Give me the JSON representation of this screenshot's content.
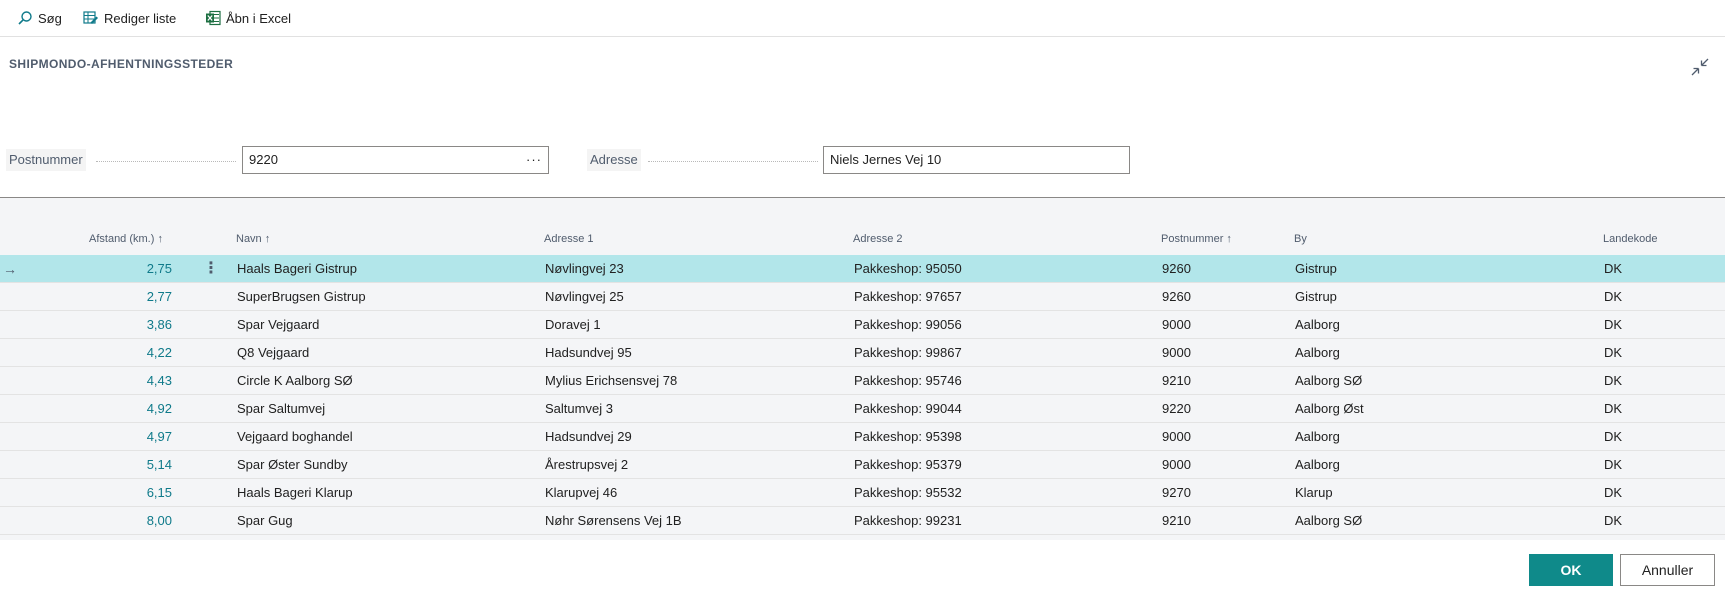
{
  "toolbar": {
    "search_label": "Søg",
    "edit_list_label": "Rediger liste",
    "open_excel_label": "Åbn i Excel"
  },
  "page": {
    "title": "SHIPMONDO-AFHENTNINGSSTEDER"
  },
  "filters": {
    "postnummer_label": "Postnummer",
    "postnummer_value": "9220",
    "adresse_label": "Adresse",
    "adresse_value": "Niels Jernes Vej 10"
  },
  "grid": {
    "columns": {
      "afstand": "Afstand (km.)",
      "navn": "Navn",
      "adresse1": "Adresse 1",
      "adresse2": "Adresse 2",
      "postnummer": "Postnummer",
      "by": "By",
      "landekode": "Landekode"
    },
    "sort_arrow": "↑",
    "rows": [
      {
        "afstand": "2,75",
        "navn": "Haals Bageri Gistrup",
        "adresse1": "Nøvlingvej 23",
        "adresse2": "Pakkeshop: 95050",
        "postnummer": "9260",
        "by": "Gistrup",
        "landekode": "DK"
      },
      {
        "afstand": "2,77",
        "navn": "SuperBrugsen Gistrup",
        "adresse1": "Nøvlingvej 25",
        "adresse2": "Pakkeshop: 97657",
        "postnummer": "9260",
        "by": "Gistrup",
        "landekode": "DK"
      },
      {
        "afstand": "3,86",
        "navn": "Spar Vejgaard",
        "adresse1": "Doravej 1",
        "adresse2": "Pakkeshop: 99056",
        "postnummer": "9000",
        "by": "Aalborg",
        "landekode": "DK"
      },
      {
        "afstand": "4,22",
        "navn": "Q8 Vejgaard",
        "adresse1": "Hadsundvej 95",
        "adresse2": "Pakkeshop: 99867",
        "postnummer": "9000",
        "by": "Aalborg",
        "landekode": "DK"
      },
      {
        "afstand": "4,43",
        "navn": "Circle K Aalborg SØ",
        "adresse1": "Mylius Erichsensvej 78",
        "adresse2": "Pakkeshop: 95746",
        "postnummer": "9210",
        "by": "Aalborg SØ",
        "landekode": "DK"
      },
      {
        "afstand": "4,92",
        "navn": "Spar Saltumvej",
        "adresse1": "Saltumvej 3",
        "adresse2": "Pakkeshop: 99044",
        "postnummer": "9220",
        "by": "Aalborg Øst",
        "landekode": "DK"
      },
      {
        "afstand": "4,97",
        "navn": "Vejgaard boghandel",
        "adresse1": "Hadsundvej 29",
        "adresse2": "Pakkeshop: 95398",
        "postnummer": "9000",
        "by": "Aalborg",
        "landekode": "DK"
      },
      {
        "afstand": "5,14",
        "navn": "Spar Øster Sundby",
        "adresse1": "Årestrupsvej 2",
        "adresse2": "Pakkeshop: 95379",
        "postnummer": "9000",
        "by": "Aalborg",
        "landekode": "DK"
      },
      {
        "afstand": "6,15",
        "navn": "Haals Bageri Klarup",
        "adresse1": "Klarupvej 46",
        "adresse2": "Pakkeshop: 95532",
        "postnummer": "9270",
        "by": "Klarup",
        "landekode": "DK"
      },
      {
        "afstand": "8,00",
        "navn": "Spar Gug",
        "adresse1": "Nøhr Sørensens Vej 1B",
        "adresse2": "Pakkeshop: 99231",
        "postnummer": "9210",
        "by": "Aalborg SØ",
        "landekode": "DK"
      }
    ]
  },
  "footer": {
    "ok_label": "OK",
    "cancel_label": "Annuller"
  },
  "colors": {
    "accent": "#0f8a8a",
    "selected_row": "#b2e6ea",
    "distance_text": "#0f7a8a"
  },
  "icons": {
    "search": "search-icon",
    "edit_list": "edit-list-icon",
    "excel": "excel-icon",
    "collapse": "collapse-icon",
    "row_arrow": "arrow-right-icon",
    "row_menu": "vertical-ellipsis-icon"
  }
}
